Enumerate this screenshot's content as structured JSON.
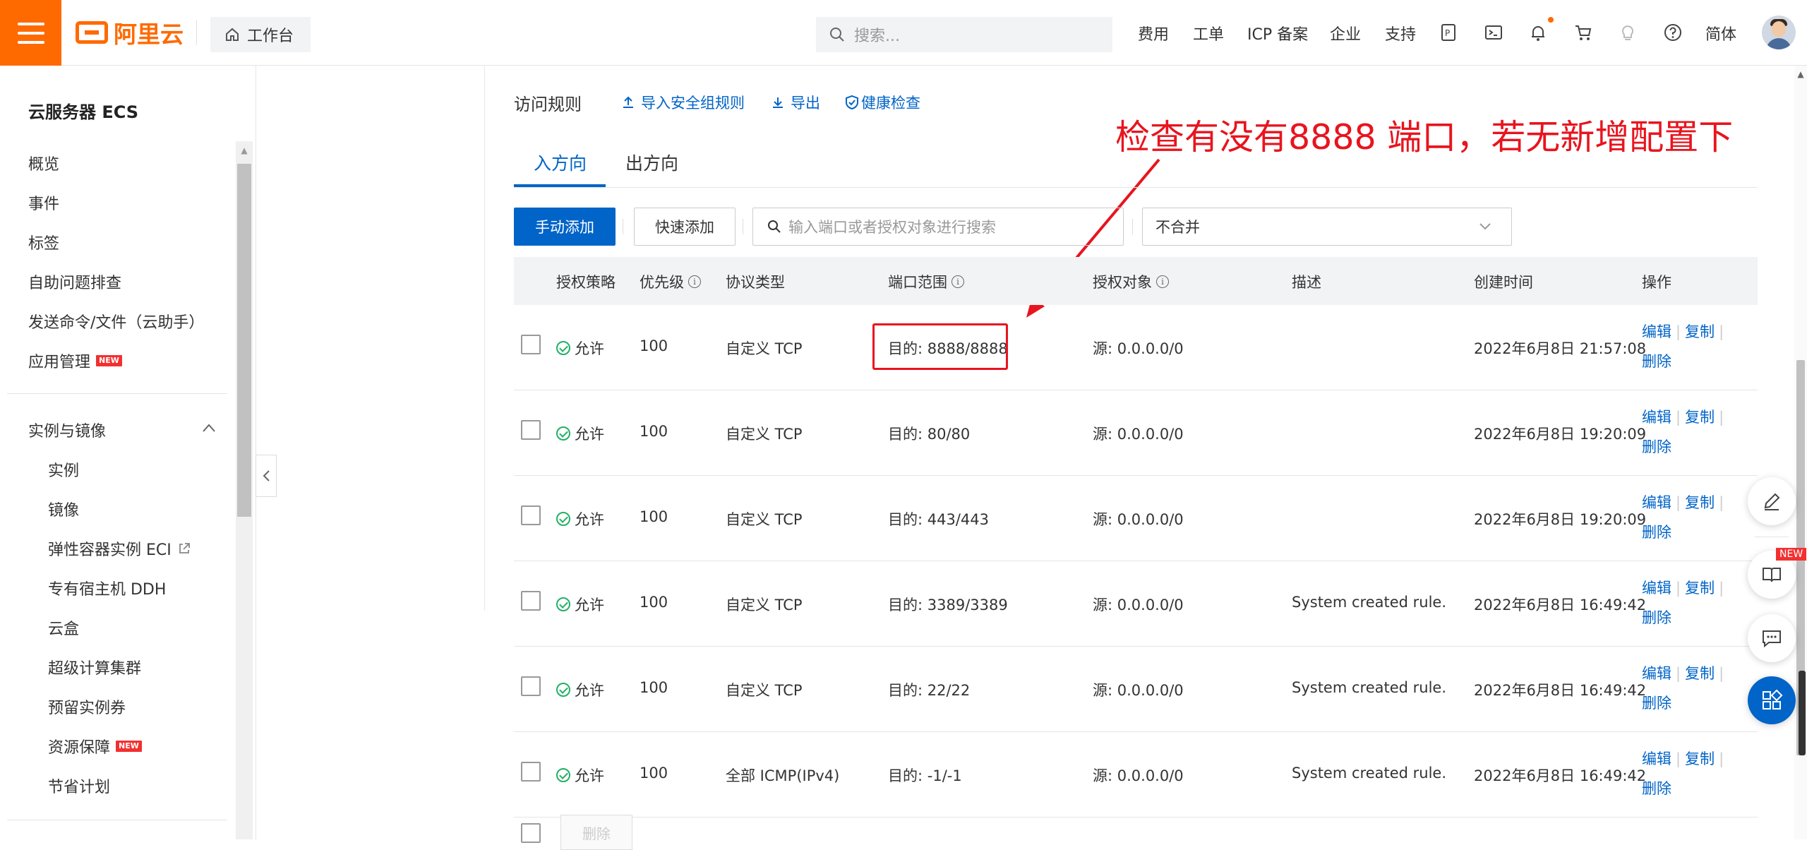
{
  "topbar": {
    "brand": "阿里云",
    "workbench": "工作台",
    "search_placeholder": "搜索...",
    "nav": [
      "费用",
      "工单",
      "ICP 备案",
      "企业",
      "支持"
    ],
    "language": "简体"
  },
  "sidebar": {
    "title": "云服务器 ECS",
    "items": [
      "概览",
      "事件",
      "标签",
      "自助问题排查",
      "发送命令/文件（云助手）",
      "应用管理"
    ],
    "new_badge": "NEW",
    "group_title": "实例与镜像",
    "group_items": [
      "实例",
      "镜像",
      "弹性容器实例 ECI",
      "专有宿主机 DDH",
      "云盒",
      "超级计算集群",
      "预留实例券",
      "资源保障",
      "节省计划"
    ]
  },
  "main": {
    "section_title": "访问规则",
    "links": [
      "导入安全组规则",
      "导出",
      "健康检查"
    ],
    "tabs": [
      "入方向",
      "出方向"
    ],
    "add_manual": "手动添加",
    "add_quick": "快速添加",
    "filter_placeholder": "输入端口或者授权对象进行搜索",
    "merge_select": "不合并",
    "columns": [
      "授权策略",
      "优先级",
      "协议类型",
      "端口范围",
      "授权对象",
      "描述",
      "创建时间",
      "操作"
    ],
    "rows": [
      {
        "policy": "允许",
        "priority": "100",
        "protocol": "自定义 TCP",
        "port": "目的: 8888/8888",
        "source": "源: 0.0.0.0/0",
        "desc": "",
        "created": "2022年6月8日 21:57:08"
      },
      {
        "policy": "允许",
        "priority": "100",
        "protocol": "自定义 TCP",
        "port": "目的: 80/80",
        "source": "源: 0.0.0.0/0",
        "desc": "",
        "created": "2022年6月8日 19:20:09"
      },
      {
        "policy": "允许",
        "priority": "100",
        "protocol": "自定义 TCP",
        "port": "目的: 443/443",
        "source": "源: 0.0.0.0/0",
        "desc": "",
        "created": "2022年6月8日 19:20:09"
      },
      {
        "policy": "允许",
        "priority": "100",
        "protocol": "自定义 TCP",
        "port": "目的: 3389/3389",
        "source": "源: 0.0.0.0/0",
        "desc": "System created rule.",
        "created": "2022年6月8日 16:49:42"
      },
      {
        "policy": "允许",
        "priority": "100",
        "protocol": "自定义 TCP",
        "port": "目的: 22/22",
        "source": "源: 0.0.0.0/0",
        "desc": "System created rule.",
        "created": "2022年6月8日 16:49:42"
      },
      {
        "policy": "允许",
        "priority": "100",
        "protocol": "全部 ICMP(IPv4)",
        "port": "目的: -1/-1",
        "source": "源: 0.0.0.0/0",
        "desc": "System created rule.",
        "created": "2022年6月8日 16:49:42"
      }
    ],
    "op_edit": "编辑",
    "op_copy": "复制",
    "op_delete": "删除",
    "bulk_delete": "删除"
  },
  "annotation": "检查有没有8888 端口，若无新增配置下",
  "fab_new_badge": "NEW",
  "colors": {
    "brand": "#ff6a00",
    "primary": "#0064c8",
    "annotation": "#e8141e",
    "success": "#23b066"
  }
}
